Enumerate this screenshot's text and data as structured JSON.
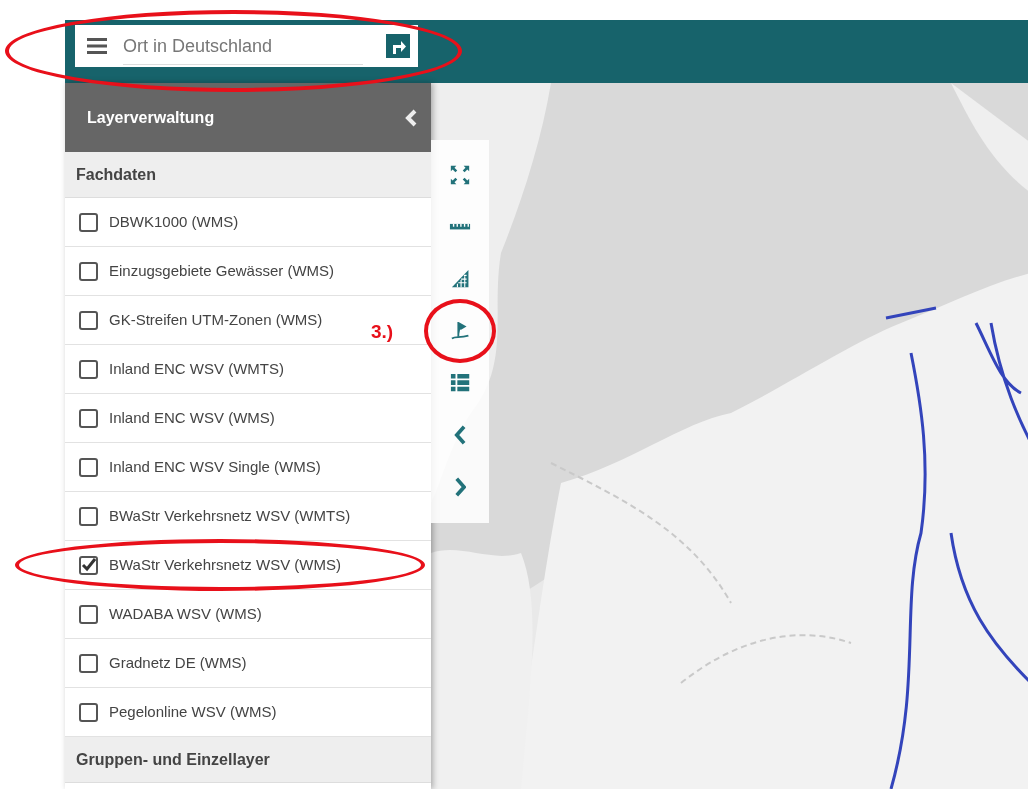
{
  "search": {
    "placeholder": "Ort in Deutschland",
    "highlighted": true
  },
  "sidebar": {
    "title": "Layerverwaltung",
    "sections": [
      {
        "title": "Fachdaten",
        "layers": [
          {
            "label": "DBWK1000 (WMS)",
            "checked": false
          },
          {
            "label": "Einzugsgebiete Gewässer (WMS)",
            "checked": false
          },
          {
            "label": "GK-Streifen UTM-Zonen (WMS)",
            "checked": false
          },
          {
            "label": "Inland ENC WSV (WMTS)",
            "checked": false
          },
          {
            "label": "Inland ENC WSV (WMS)",
            "checked": false
          },
          {
            "label": "Inland ENC WSV Single (WMS)",
            "checked": false
          },
          {
            "label": "BWaStr Verkehrsnetz WSV (WMTS)",
            "checked": false
          },
          {
            "label": "BWaStr Verkehrsnetz WSV (WMS)",
            "checked": true,
            "highlighted": true
          },
          {
            "label": "WADABA WSV (WMS)",
            "checked": false
          },
          {
            "label": "Gradnetz DE (WMS)",
            "checked": false
          },
          {
            "label": "Pegelonline WSV (WMS)",
            "checked": false
          }
        ]
      },
      {
        "title": "Gruppen- und Einzellayer"
      }
    ]
  },
  "tools": [
    {
      "kind": "fullscreen"
    },
    {
      "kind": "ruler"
    },
    {
      "kind": "area"
    },
    {
      "kind": "flag",
      "highlighted": true,
      "callout": "3.)"
    },
    {
      "kind": "list"
    },
    {
      "kind": "prev"
    },
    {
      "kind": "next"
    }
  ]
}
